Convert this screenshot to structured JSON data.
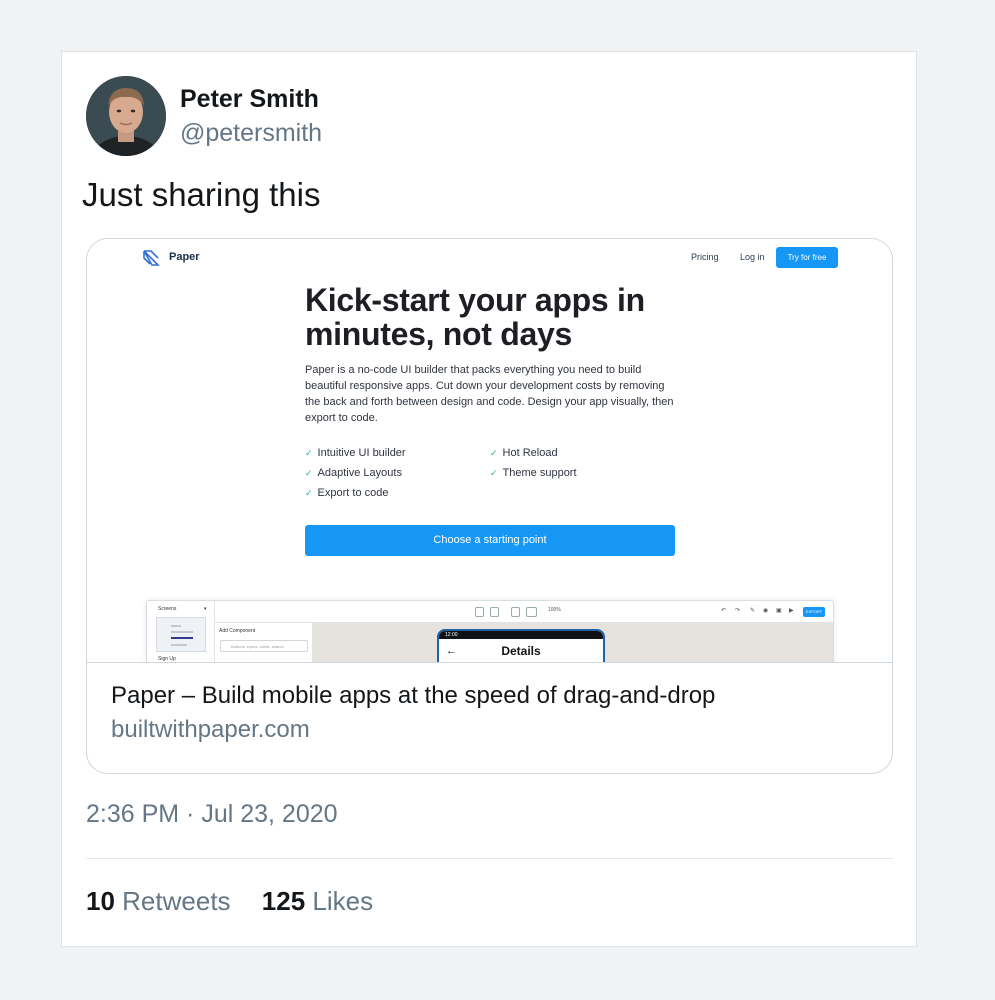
{
  "tweet": {
    "author_name": "Peter Smith",
    "author_handle": "@petersmith",
    "text": "Just sharing this",
    "timestamp": "2:36 PM · Jul 23, 2020",
    "retweets_count": "10",
    "retweets_label": "Retweets",
    "likes_count": "125",
    "likes_label": "Likes"
  },
  "card": {
    "title": "Paper – Build mobile apps at the speed of drag-and-drop",
    "domain": "builtwithpaper.com",
    "preview": {
      "brand": "Paper",
      "nav": {
        "pricing": "Pricing",
        "login": "Log in",
        "try": "Try for free"
      },
      "headline": "Kick-start your apps in minutes, not days",
      "description": "Paper is a no-code UI builder that packs everything you need to build beautiful responsive apps. Cut down your development costs by removing the back and forth between design and code. Design your app visually, then export to code.",
      "check_glyph": "✓",
      "features": [
        "Intuitive UI builder",
        "Hot Reload",
        "Adaptive Layouts",
        "Theme support",
        "Export to code"
      ],
      "cta": "Choose a starting point",
      "app": {
        "screens_label": "Screens",
        "screen_name": "Sign Up",
        "add_component": "Add Component",
        "search_placeholder": "Buttons, inputs, cards, search",
        "zoom": "100%",
        "export": "EXPORT",
        "status_time": "12:00",
        "phone_title": "Details",
        "back_glyph": "←"
      }
    }
  },
  "colors": {
    "brand_blue": "#1797f5",
    "check_green": "#26b09b",
    "muted_text": "#657786"
  },
  "icons": [
    "paper-logo-icon",
    "check-icon",
    "back-arrow-icon"
  ]
}
